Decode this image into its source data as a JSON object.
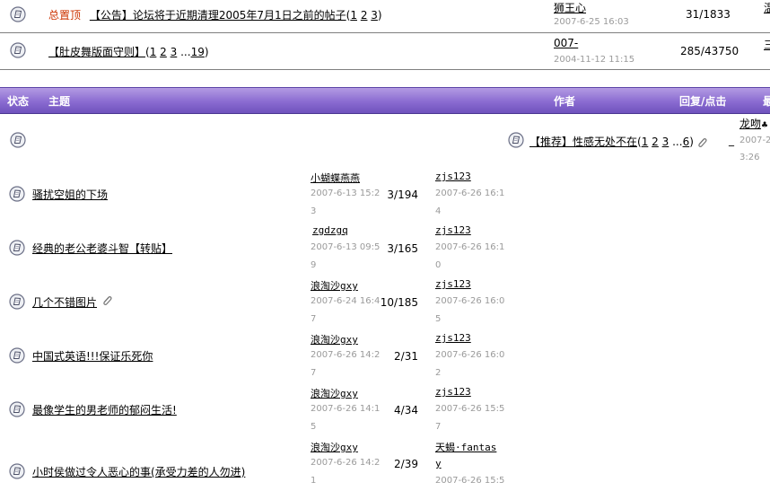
{
  "pinned": [
    {
      "tag": "总置顶",
      "title": "【公告】论坛将于近期清理2005年7月1日之前的帖子",
      "pages_open": "(",
      "pages": [
        "1",
        "2",
        "3"
      ],
      "pages_close": ")",
      "author": "狮王心",
      "date": "2007-6-25 16:03",
      "replies": "31/1833",
      "last_cut": "温"
    },
    {
      "title": "【肚皮舞版面守则】",
      "pages_open": "(",
      "pages": [
        "1",
        "2",
        "3"
      ],
      "pages_ellipsis": "...",
      "pages_last": "19",
      "pages_close": ")",
      "author": "007-",
      "date": "2004-11-12 11:15",
      "replies": "285/43750",
      "last_cut": "三"
    }
  ],
  "header": {
    "status": "状态",
    "topic": "主题",
    "author": "作者",
    "replies": "回复/点击",
    "last_cut": "最"
  },
  "recommended": {
    "title": "【推荐】性感无处不在",
    "pages_open": "(",
    "pages": [
      "1",
      "2",
      "3"
    ],
    "pages_ellipsis": "...",
    "pages_last": "6",
    "pages_close": ")",
    "author": "龙吻",
    "author_suffix": "♣",
    "date_line1": "2007-2",
    "date_line2": "3:26",
    "dash": "_"
  },
  "threads": [
    {
      "title": "骚扰空姐的下场",
      "author": "小蝴蝶燕燕",
      "date1": "2007-6-13 15:2",
      "date2": "3",
      "replies": "3/194",
      "last_author": "zjs123",
      "last1": "2007-6-26 16:1",
      "last2": "4"
    },
    {
      "title": "经典的老公老婆斗智【转贴】",
      "author": "zgdzgq",
      "date1": "2007-6-13 09:5",
      "date2": "9",
      "replies": "3/165",
      "last_author": "zjs123",
      "last1": "2007-6-26 16:1",
      "last2": "0"
    },
    {
      "title": "几个不错图片",
      "author": "浪淘沙gxy",
      "date1": "2007-6-24 16:4",
      "date2": "7",
      "replies": "10/185",
      "last_author": "zjs123",
      "last1": "2007-6-26 16:0",
      "last2": "5"
    },
    {
      "title": "中国式英语!!!保证乐死你",
      "author": "浪淘沙gxy",
      "date1": "2007-6-26 14:2",
      "date2": "7",
      "replies": "2/31",
      "last_author": "zjs123",
      "last1": "2007-6-26 16:0",
      "last2": "2"
    },
    {
      "title": "最像学生的男老师的郁闷生活!",
      "author": "浪淘沙gxy",
      "date1": "2007-6-26 14:1",
      "date2": "5",
      "replies": "4/34",
      "last_author": "zjs123",
      "last1": "2007-6-26 15:5",
      "last2": "7"
    },
    {
      "title": "小时侯做过令人恶心的事(承受力差的人勿进)",
      "author": "浪淘沙gxy",
      "date1": "2007-6-26 14:2",
      "date2": "1",
      "replies": "2/39",
      "last_author": "天蝎·fantas",
      "last_author2": "y",
      "last1": "2007-6-26 15:5",
      "last2": ""
    }
  ]
}
